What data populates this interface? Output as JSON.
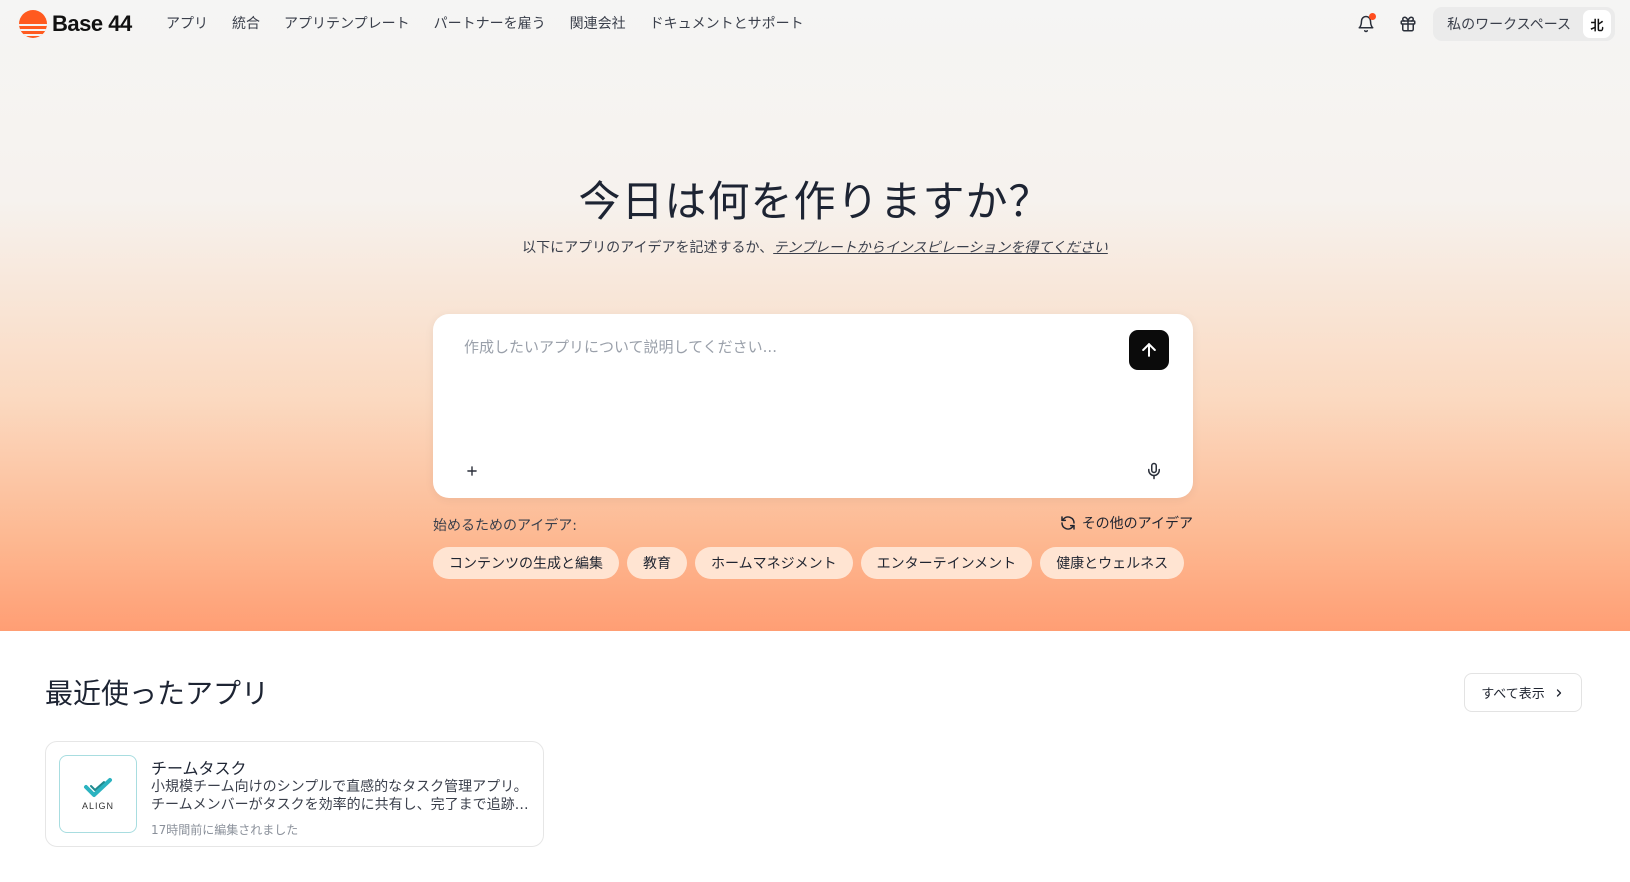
{
  "nav": {
    "brand": "Base 44",
    "links": [
      "アプリ",
      "統合",
      "アプリテンプレート",
      "パートナーを雇う",
      "関連会社",
      "ドキュメントとサポート"
    ],
    "workspace_label": "私のワークスペース",
    "avatar_initial": "北",
    "accent_color": "#ff5a1f"
  },
  "hero": {
    "headline": "今日は何を作りますか？",
    "subline_prefix": "以下にアプリのアイデアを記述するか、",
    "subline_link": "テンプレートからインスピレーションを得てください",
    "prompt_placeholder": "作成したいアプリについて説明してください...",
    "ideas_label": "始めるためのアイデア:",
    "more_ideas_label": "その他のアイデア",
    "chips": [
      "コンテンツの生成と編集",
      "教育",
      "ホームマネジメント",
      "エンターテインメント",
      "健康とウェルネス"
    ]
  },
  "recent": {
    "title": "最近使ったアプリ",
    "see_all_label": "すべて表示",
    "apps": [
      {
        "name": "チームタスク",
        "description": "小規模チーム向けのシンプルで直感的なタスク管理アプリ。チームメンバーがタスクを効率的に共有し、完了まで追跡できます。",
        "edited": "17時間前に編集されました",
        "thumb_text": "ALIGN"
      }
    ]
  }
}
